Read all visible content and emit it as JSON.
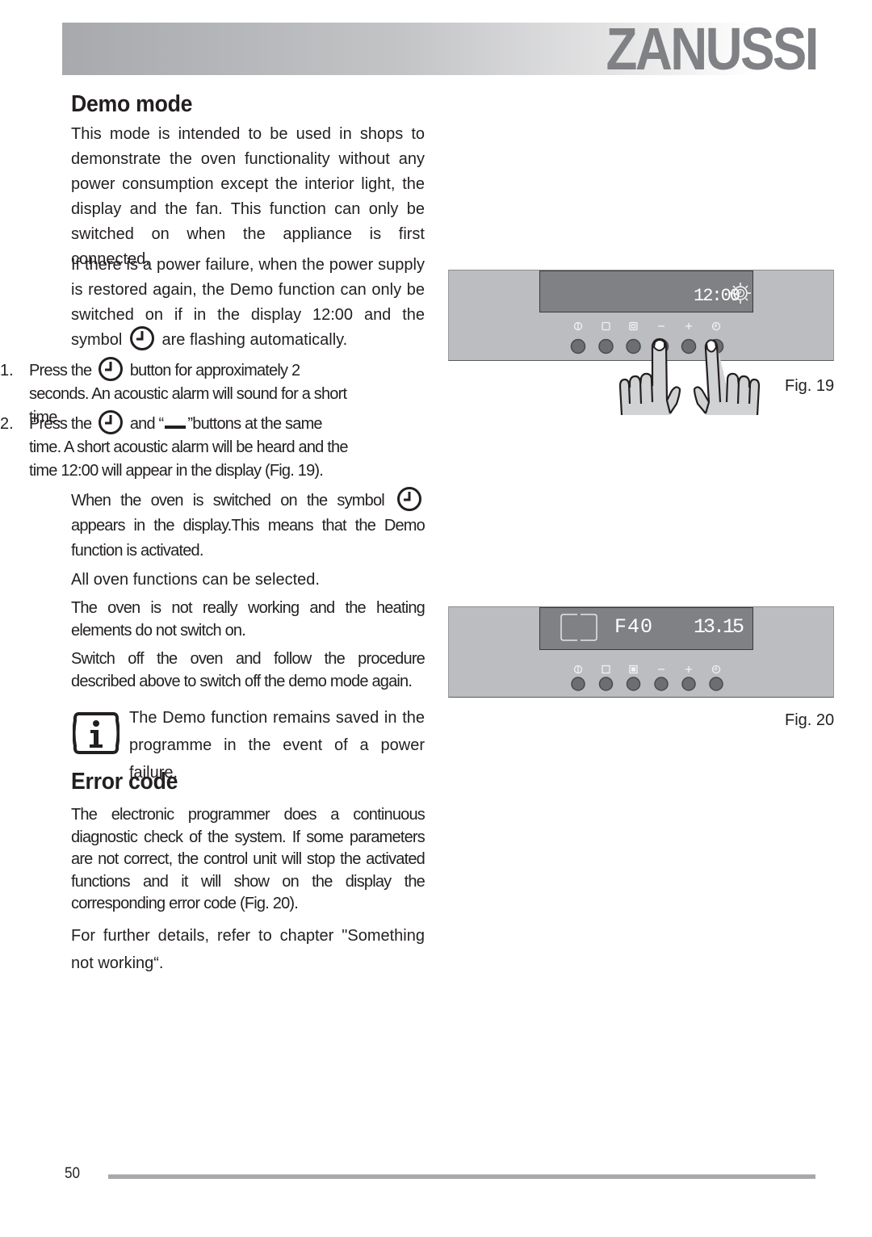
{
  "header": {
    "brand": "ZANUSSI"
  },
  "demo_mode": {
    "title": "Demo mode",
    "intro": "This mode is intended to be used in shops to demonstrate the oven functionality without any power consumption except the interior light, the display and the fan. This function can only be switched on when the appliance is first connected.",
    "power_failure": {
      "before_symbol": "If there is a power failure, when the power supply is restored again,  the Demo function can only be switched on if in the display  12:00 and the symbol",
      "after_symbol": "are flashing automatically."
    },
    "steps": [
      {
        "number": "1.",
        "before_symbol": "Press the",
        "after_symbol": "button for approximately 2 seconds. An acoustic alarm will sound for a short time."
      },
      {
        "number": "2.",
        "before_symbol": "Press the",
        "middle": "and “",
        "after_dash": "”buttons at the same time. A short acoustic alarm will be heard and the time 12:00 will appear in the display (Fig. 19)."
      }
    ],
    "switched_on": {
      "before_symbol": "When the oven is switched on the symbol",
      "after_symbol": "appears in the display.This means that the Demo function is activated."
    },
    "all_functions": "All oven functions can be selected.",
    "not_working": "The oven is not really working and the heating elements do not switch on.",
    "switch_off": "Switch off the oven and follow the procedure described above to switch off the demo mode again.",
    "note": "The Demo function remains saved in the programme in the event of a power failure."
  },
  "error_code": {
    "title": "Error code",
    "body": "The electronic programmer does a continuous diagnostic check of the system. If some parameters are not correct, the control unit will stop the activated functions and it will show on the display the corresponding error code (Fig. 20).",
    "further": "For further details, refer to chapter \"Something not working“."
  },
  "figures": {
    "fig19": {
      "label": "Fig. 19",
      "display_time": "12:00",
      "icons": [
        "power-icon",
        "light-icon",
        "function-icon",
        "minus-icon",
        "plus-icon",
        "clock-icon"
      ]
    },
    "fig20": {
      "label": "Fig. 20",
      "error_code": "F40",
      "display_time": "13.15",
      "icons": [
        "power-icon",
        "light-icon",
        "function-icon",
        "minus-icon",
        "plus-icon",
        "clock-icon"
      ]
    }
  },
  "footer": {
    "page_number": "50"
  }
}
